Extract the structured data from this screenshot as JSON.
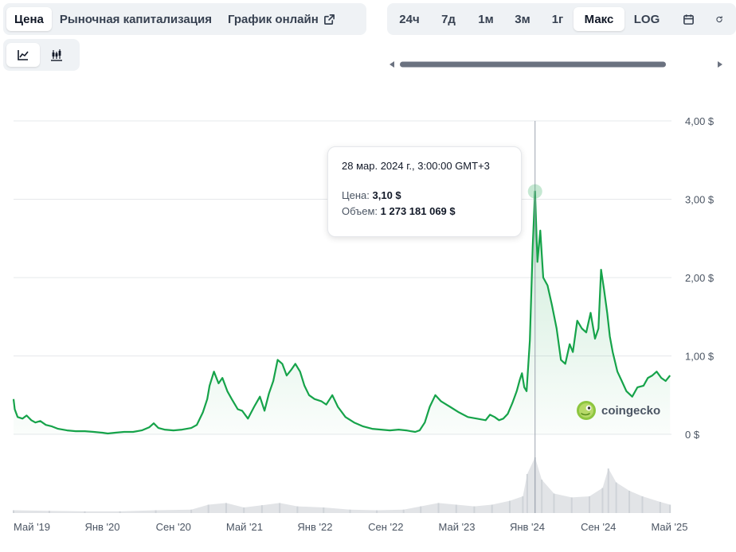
{
  "tabs": [
    {
      "label": "Цена",
      "active": true
    },
    {
      "label": "Рыночная капитализация",
      "active": false
    },
    {
      "label": "График онлайн",
      "active": false,
      "icon": "external-link-icon"
    }
  ],
  "chart_type_buttons": [
    {
      "icon": "line-chart-icon",
      "active": true
    },
    {
      "icon": "candlestick-icon",
      "active": false
    }
  ],
  "ranges": [
    {
      "label": "24ч",
      "active": false
    },
    {
      "label": "7д",
      "active": false
    },
    {
      "label": "1м",
      "active": false
    },
    {
      "label": "3м",
      "active": false
    },
    {
      "label": "1г",
      "active": false
    },
    {
      "label": "Макс",
      "active": true
    },
    {
      "label": "LOG",
      "active": false
    }
  ],
  "range_icons": [
    "calendar-icon",
    "refresh-icon"
  ],
  "tooltip": {
    "date": "28 мар. 2024 г., 3:00:00 GMT+3",
    "price_label": "Цена:",
    "price_value": "3,10 $",
    "volume_label": "Объем:",
    "volume_value": "1 273 181 069 $"
  },
  "brand": {
    "name": "coingecko",
    "icon": "gecko-logo-icon"
  },
  "colors": {
    "line": "#16a34a",
    "accent_bg": "#eff2f5",
    "volume": "#e2e4e7",
    "grid": "#e6e8eb"
  },
  "chart_data": {
    "type": "area",
    "currency": "$",
    "ylim": [
      0,
      4
    ],
    "yticks": [
      {
        "value": 0,
        "label": "0 $"
      },
      {
        "value": 1,
        "label": "1,00 $"
      },
      {
        "value": 2,
        "label": "2,00 $"
      },
      {
        "value": 3,
        "label": "3,00 $"
      },
      {
        "value": 4,
        "label": "4,00 $"
      }
    ],
    "xlim": [
      "2019-05-01",
      "2025-07-10"
    ],
    "xticks": [
      {
        "date": "2019-05-01",
        "label": "Май '19"
      },
      {
        "date": "2020-01-01",
        "label": "Янв '20"
      },
      {
        "date": "2020-09-01",
        "label": "Сен '20"
      },
      {
        "date": "2021-05-01",
        "label": "Май '21"
      },
      {
        "date": "2022-01-01",
        "label": "Янв '22"
      },
      {
        "date": "2022-09-01",
        "label": "Сен '22"
      },
      {
        "date": "2023-05-01",
        "label": "Май '23"
      },
      {
        "date": "2024-01-01",
        "label": "Янв '24"
      },
      {
        "date": "2024-09-01",
        "label": "Сен '24"
      },
      {
        "date": "2025-05-01",
        "label": "Май '25"
      }
    ],
    "series": [
      {
        "x": [
          "2019-05-01",
          "2019-05-05",
          "2019-05-15",
          "2019-06-01",
          "2019-06-15",
          "2019-07-01",
          "2019-07-15",
          "2019-08-01",
          "2019-08-20",
          "2019-09-10",
          "2019-10-01",
          "2019-11-01",
          "2019-12-01",
          "2020-01-01",
          "2020-02-01",
          "2020-03-01",
          "2020-03-20",
          "2020-04-15",
          "2020-05-15",
          "2020-06-15",
          "2020-07-15",
          "2020-08-10",
          "2020-08-25",
          "2020-09-10",
          "2020-10-01",
          "2020-11-01",
          "2020-12-01",
          "2021-01-01",
          "2021-01-20",
          "2021-02-10",
          "2021-02-25",
          "2021-03-05",
          "2021-03-20",
          "2021-04-05",
          "2021-04-18",
          "2021-05-05",
          "2021-05-20",
          "2021-06-10",
          "2021-06-25",
          "2021-07-15",
          "2021-08-05",
          "2021-08-25",
          "2021-09-10",
          "2021-09-25",
          "2021-10-10",
          "2021-10-25",
          "2021-11-10",
          "2021-11-25",
          "2021-12-10",
          "2021-12-25",
          "2022-01-10",
          "2022-01-25",
          "2022-02-10",
          "2022-03-01",
          "2022-03-25",
          "2022-04-10",
          "2022-05-01",
          "2022-05-20",
          "2022-06-15",
          "2022-07-15",
          "2022-08-15",
          "2022-09-15",
          "2022-10-15",
          "2022-11-15",
          "2022-12-15",
          "2023-01-10",
          "2023-01-25",
          "2023-02-10",
          "2023-02-25",
          "2023-03-15",
          "2023-04-01",
          "2023-04-20",
          "2023-05-10",
          "2023-06-10",
          "2023-07-10",
          "2023-08-10",
          "2023-09-10",
          "2023-10-10",
          "2023-10-25",
          "2023-11-10",
          "2023-11-25",
          "2023-12-10",
          "2023-12-25",
          "2024-01-10",
          "2024-01-25",
          "2024-02-05",
          "2024-02-12",
          "2024-02-20",
          "2024-02-28",
          "2024-03-10",
          "2024-03-20",
          "2024-03-28",
          "2024-04-05",
          "2024-04-15",
          "2024-04-25",
          "2024-05-10",
          "2024-05-25",
          "2024-06-10",
          "2024-06-25",
          "2024-07-10",
          "2024-07-25",
          "2024-08-05",
          "2024-08-20",
          "2024-09-05",
          "2024-09-20",
          "2024-10-05",
          "2024-10-20",
          "2024-11-01",
          "2024-11-10",
          "2024-11-20",
          "2024-12-01",
          "2024-12-10",
          "2024-12-20",
          "2025-01-05",
          "2025-01-20",
          "2025-02-05",
          "2025-02-25",
          "2025-03-15",
          "2025-04-05",
          "2025-04-20",
          "2025-05-05",
          "2025-05-20",
          "2025-06-05",
          "2025-06-20",
          "2025-07-05"
        ],
        "y": [
          0.45,
          0.32,
          0.22,
          0.2,
          0.24,
          0.18,
          0.15,
          0.17,
          0.12,
          0.1,
          0.07,
          0.05,
          0.04,
          0.04,
          0.03,
          0.02,
          0.01,
          0.02,
          0.03,
          0.03,
          0.05,
          0.09,
          0.14,
          0.08,
          0.06,
          0.05,
          0.06,
          0.08,
          0.12,
          0.28,
          0.45,
          0.62,
          0.8,
          0.65,
          0.72,
          0.55,
          0.45,
          0.32,
          0.3,
          0.2,
          0.35,
          0.48,
          0.3,
          0.52,
          0.68,
          0.95,
          0.9,
          0.75,
          0.82,
          0.9,
          0.8,
          0.62,
          0.5,
          0.45,
          0.42,
          0.38,
          0.5,
          0.35,
          0.22,
          0.15,
          0.1,
          0.07,
          0.06,
          0.05,
          0.06,
          0.05,
          0.04,
          0.03,
          0.05,
          0.15,
          0.35,
          0.5,
          0.42,
          0.35,
          0.28,
          0.22,
          0.2,
          0.18,
          0.25,
          0.22,
          0.18,
          0.2,
          0.26,
          0.4,
          0.55,
          0.7,
          0.78,
          0.6,
          0.55,
          1.2,
          2.4,
          3.1,
          2.2,
          2.6,
          2.0,
          1.9,
          1.65,
          1.35,
          0.95,
          0.9,
          1.15,
          1.05,
          1.45,
          1.35,
          1.3,
          1.55,
          1.22,
          1.35,
          2.1,
          1.85,
          1.55,
          1.25,
          1.05,
          0.8,
          0.68,
          0.55,
          0.48,
          0.6,
          0.62,
          0.72,
          0.75,
          0.8,
          0.72,
          0.68,
          0.75
        ]
      }
    ],
    "tooltip_point": {
      "date": "2024-03-28",
      "value": 3.1
    },
    "volume": {
      "x": [
        "2019-05-01",
        "2019-09-01",
        "2020-01-01",
        "2020-05-01",
        "2020-09-01",
        "2021-01-01",
        "2021-03-01",
        "2021-05-01",
        "2021-07-01",
        "2021-09-01",
        "2021-11-01",
        "2022-01-01",
        "2022-04-01",
        "2022-07-01",
        "2022-10-01",
        "2023-01-01",
        "2023-03-01",
        "2023-05-01",
        "2023-07-01",
        "2023-09-01",
        "2023-11-01",
        "2024-01-01",
        "2024-02-15",
        "2024-03-01",
        "2024-03-28",
        "2024-04-20",
        "2024-06-01",
        "2024-08-01",
        "2024-10-01",
        "2024-11-15",
        "2024-12-05",
        "2025-01-01",
        "2025-02-15",
        "2025-04-01",
        "2025-06-01",
        "2025-07-05"
      ],
      "y": [
        0.05,
        0.04,
        0.03,
        0.03,
        0.05,
        0.06,
        0.15,
        0.18,
        0.1,
        0.14,
        0.18,
        0.12,
        0.1,
        0.06,
        0.05,
        0.06,
        0.12,
        0.18,
        0.15,
        0.12,
        0.15,
        0.22,
        0.3,
        0.7,
        1.0,
        0.6,
        0.35,
        0.28,
        0.3,
        0.45,
        0.8,
        0.55,
        0.4,
        0.3,
        0.2,
        0.15
      ]
    }
  }
}
